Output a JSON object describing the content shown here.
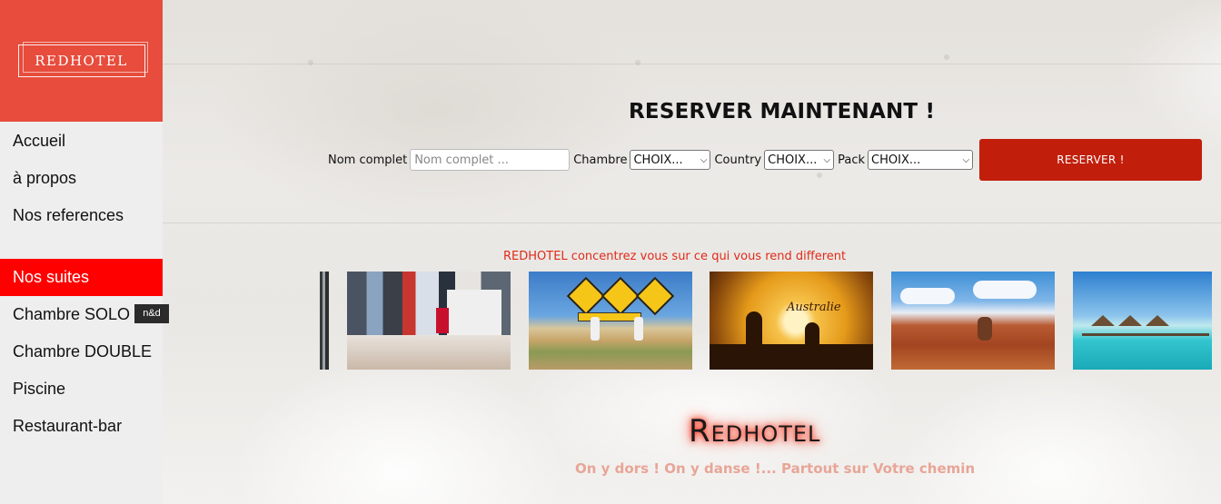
{
  "sidebar": {
    "logo_text": "REDHOTEL",
    "nav_items": [
      "Accueil",
      "à propos",
      "Nos references"
    ],
    "section_title": "Nos suites",
    "suite_items": [
      "Chambre SOLO",
      "Chambre DOUBLE",
      "Piscine",
      "Restaurant-bar"
    ],
    "tooltip": "n&d"
  },
  "booking": {
    "title": "RESERVER MAINTENANT !",
    "name_label": "Nom complet",
    "name_placeholder": "Nom complet ...",
    "chambre_label": "Chambre",
    "chambre_value": "CHOIX...",
    "country_label": "Country",
    "country_value": "CHOIX...",
    "pack_label": "Pack",
    "pack_value": "CHOIX...",
    "submit_label": "RESERVER !"
  },
  "tagline": "REDHOTEL concentrez vous sur ce qui vous rend different",
  "photos": [
    {
      "icon": "city-photo-partial"
    },
    {
      "icon": "times-square-photo"
    },
    {
      "icon": "kangaroo-signs-photo"
    },
    {
      "icon": "australia-sunset-kangaroo-photo",
      "caption": "Australie"
    },
    {
      "icon": "red-rock-outback-photo"
    },
    {
      "icon": "maldives-overwater-bungalow-photo"
    }
  ],
  "footer": {
    "brand": "Redhotel",
    "slogan": "On y dors ! On y danse !... Partout sur Votre chemin"
  },
  "colors": {
    "logo_bg": "#e74c3c",
    "active_nav": "#ff0000",
    "button": "#c11f0b",
    "tagline": "#e02a1a",
    "slogan": "#e8a597"
  }
}
